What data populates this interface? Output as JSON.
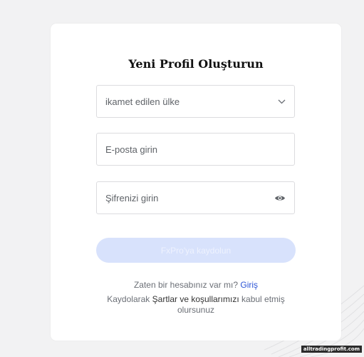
{
  "form": {
    "title": "Yeni Profil Oluşturun",
    "country_placeholder": "ikamet edilen ülke",
    "email_placeholder": "E-posta girin",
    "password_placeholder": "Şifrenizi girin",
    "submit_label": "FxPro'ya kaydolun",
    "login_prompt": "Zaten bir hesabınız var mı?",
    "login_link": "Giriş",
    "terms_prefix": "Kaydolarak",
    "terms_link": "Şartlar ve koşullarımızı",
    "terms_suffix": "kabul etmiş olursunuz"
  },
  "icons": {
    "country_dropdown": "chevron-down-icon",
    "password_toggle": "eye-icon"
  },
  "colors": {
    "accent": "#2d55d6",
    "button_disabled_bg": "#d8e2fc",
    "page_bg": "#f2f2f3"
  },
  "watermark": "alltradingprofit.com"
}
